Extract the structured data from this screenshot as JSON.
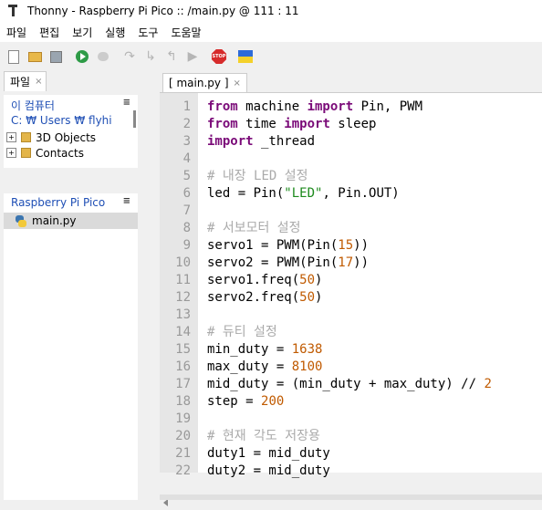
{
  "window": {
    "title": "Thonny  -  Raspberry Pi Pico :: /main.py  @  111 : 11"
  },
  "menu": [
    "파일",
    "편집",
    "보기",
    "실행",
    "도구",
    "도움말"
  ],
  "toolbar_icons": [
    "new-file-icon",
    "open-folder-icon",
    "save-icon",
    "run-icon",
    "debug-icon",
    "step-over-icon",
    "step-into-icon",
    "step-out-icon",
    "resume-icon",
    "stop-icon",
    "ukraine-flag-icon"
  ],
  "files_panel": {
    "tab_label": "파일",
    "close_glyph": "×",
    "menu_glyph": "≡",
    "computer": {
      "title": "이 컴퓨터",
      "path": "C: ₩ Users ₩ flyhi",
      "items": [
        {
          "name": "3D Objects",
          "expander": "+"
        },
        {
          "name": "Contacts",
          "expander": "+"
        }
      ]
    },
    "device": {
      "title": "Raspberry Pi Pico",
      "items": [
        {
          "name": "main.py"
        }
      ]
    }
  },
  "editor": {
    "tab_label": "[ main.py ]",
    "close_glyph": "×",
    "lines": [
      {
        "n": "1",
        "tokens": [
          {
            "t": "from",
            "c": "kw"
          },
          {
            "t": " machine "
          },
          {
            "t": "import",
            "c": "kw"
          },
          {
            "t": " Pin, PWM"
          }
        ]
      },
      {
        "n": "2",
        "tokens": [
          {
            "t": "from",
            "c": "kw"
          },
          {
            "t": " time "
          },
          {
            "t": "import",
            "c": "kw"
          },
          {
            "t": " sleep"
          }
        ]
      },
      {
        "n": "3",
        "tokens": [
          {
            "t": "import",
            "c": "kw"
          },
          {
            "t": " _thread"
          }
        ]
      },
      {
        "n": "4",
        "tokens": []
      },
      {
        "n": "5",
        "tokens": [
          {
            "t": "# 내장 LED 설정",
            "c": "cm"
          }
        ]
      },
      {
        "n": "6",
        "tokens": [
          {
            "t": "led = Pin("
          },
          {
            "t": "\"LED\"",
            "c": "st"
          },
          {
            "t": ", Pin.OUT)"
          }
        ]
      },
      {
        "n": "7",
        "tokens": []
      },
      {
        "n": "8",
        "tokens": [
          {
            "t": "# 서보모터 설정",
            "c": "cm"
          }
        ]
      },
      {
        "n": "9",
        "tokens": [
          {
            "t": "servo1 = PWM(Pin("
          },
          {
            "t": "15",
            "c": "num"
          },
          {
            "t": "))"
          }
        ]
      },
      {
        "n": "10",
        "tokens": [
          {
            "t": "servo2 = PWM(Pin("
          },
          {
            "t": "17",
            "c": "num"
          },
          {
            "t": "))"
          }
        ]
      },
      {
        "n": "11",
        "tokens": [
          {
            "t": "servo1.freq("
          },
          {
            "t": "50",
            "c": "num"
          },
          {
            "t": ")"
          }
        ]
      },
      {
        "n": "12",
        "tokens": [
          {
            "t": "servo2.freq("
          },
          {
            "t": "50",
            "c": "num"
          },
          {
            "t": ")"
          }
        ]
      },
      {
        "n": "13",
        "tokens": []
      },
      {
        "n": "14",
        "tokens": [
          {
            "t": "# 듀티 설정",
            "c": "cm"
          }
        ]
      },
      {
        "n": "15",
        "tokens": [
          {
            "t": "min_duty = "
          },
          {
            "t": "1638",
            "c": "num"
          }
        ]
      },
      {
        "n": "16",
        "tokens": [
          {
            "t": "max_duty = "
          },
          {
            "t": "8100",
            "c": "num"
          }
        ]
      },
      {
        "n": "17",
        "tokens": [
          {
            "t": "mid_duty = (min_duty + max_duty) // "
          },
          {
            "t": "2",
            "c": "num"
          }
        ]
      },
      {
        "n": "18",
        "tokens": [
          {
            "t": "step = "
          },
          {
            "t": "200",
            "c": "num"
          }
        ]
      },
      {
        "n": "19",
        "tokens": []
      },
      {
        "n": "20",
        "tokens": [
          {
            "t": "# 현재 각도 저장용",
            "c": "cm"
          }
        ]
      },
      {
        "n": "21",
        "tokens": [
          {
            "t": "duty1 = mid_duty"
          }
        ]
      },
      {
        "n": "22",
        "tokens": [
          {
            "t": "duty2 = mid_duty"
          }
        ]
      }
    ]
  },
  "colors": {
    "keyword": "#7a0a78",
    "comment": "#aaaaaa",
    "string": "#1d8a1d",
    "number": "#c05a00",
    "link": "#1f4fb5"
  }
}
